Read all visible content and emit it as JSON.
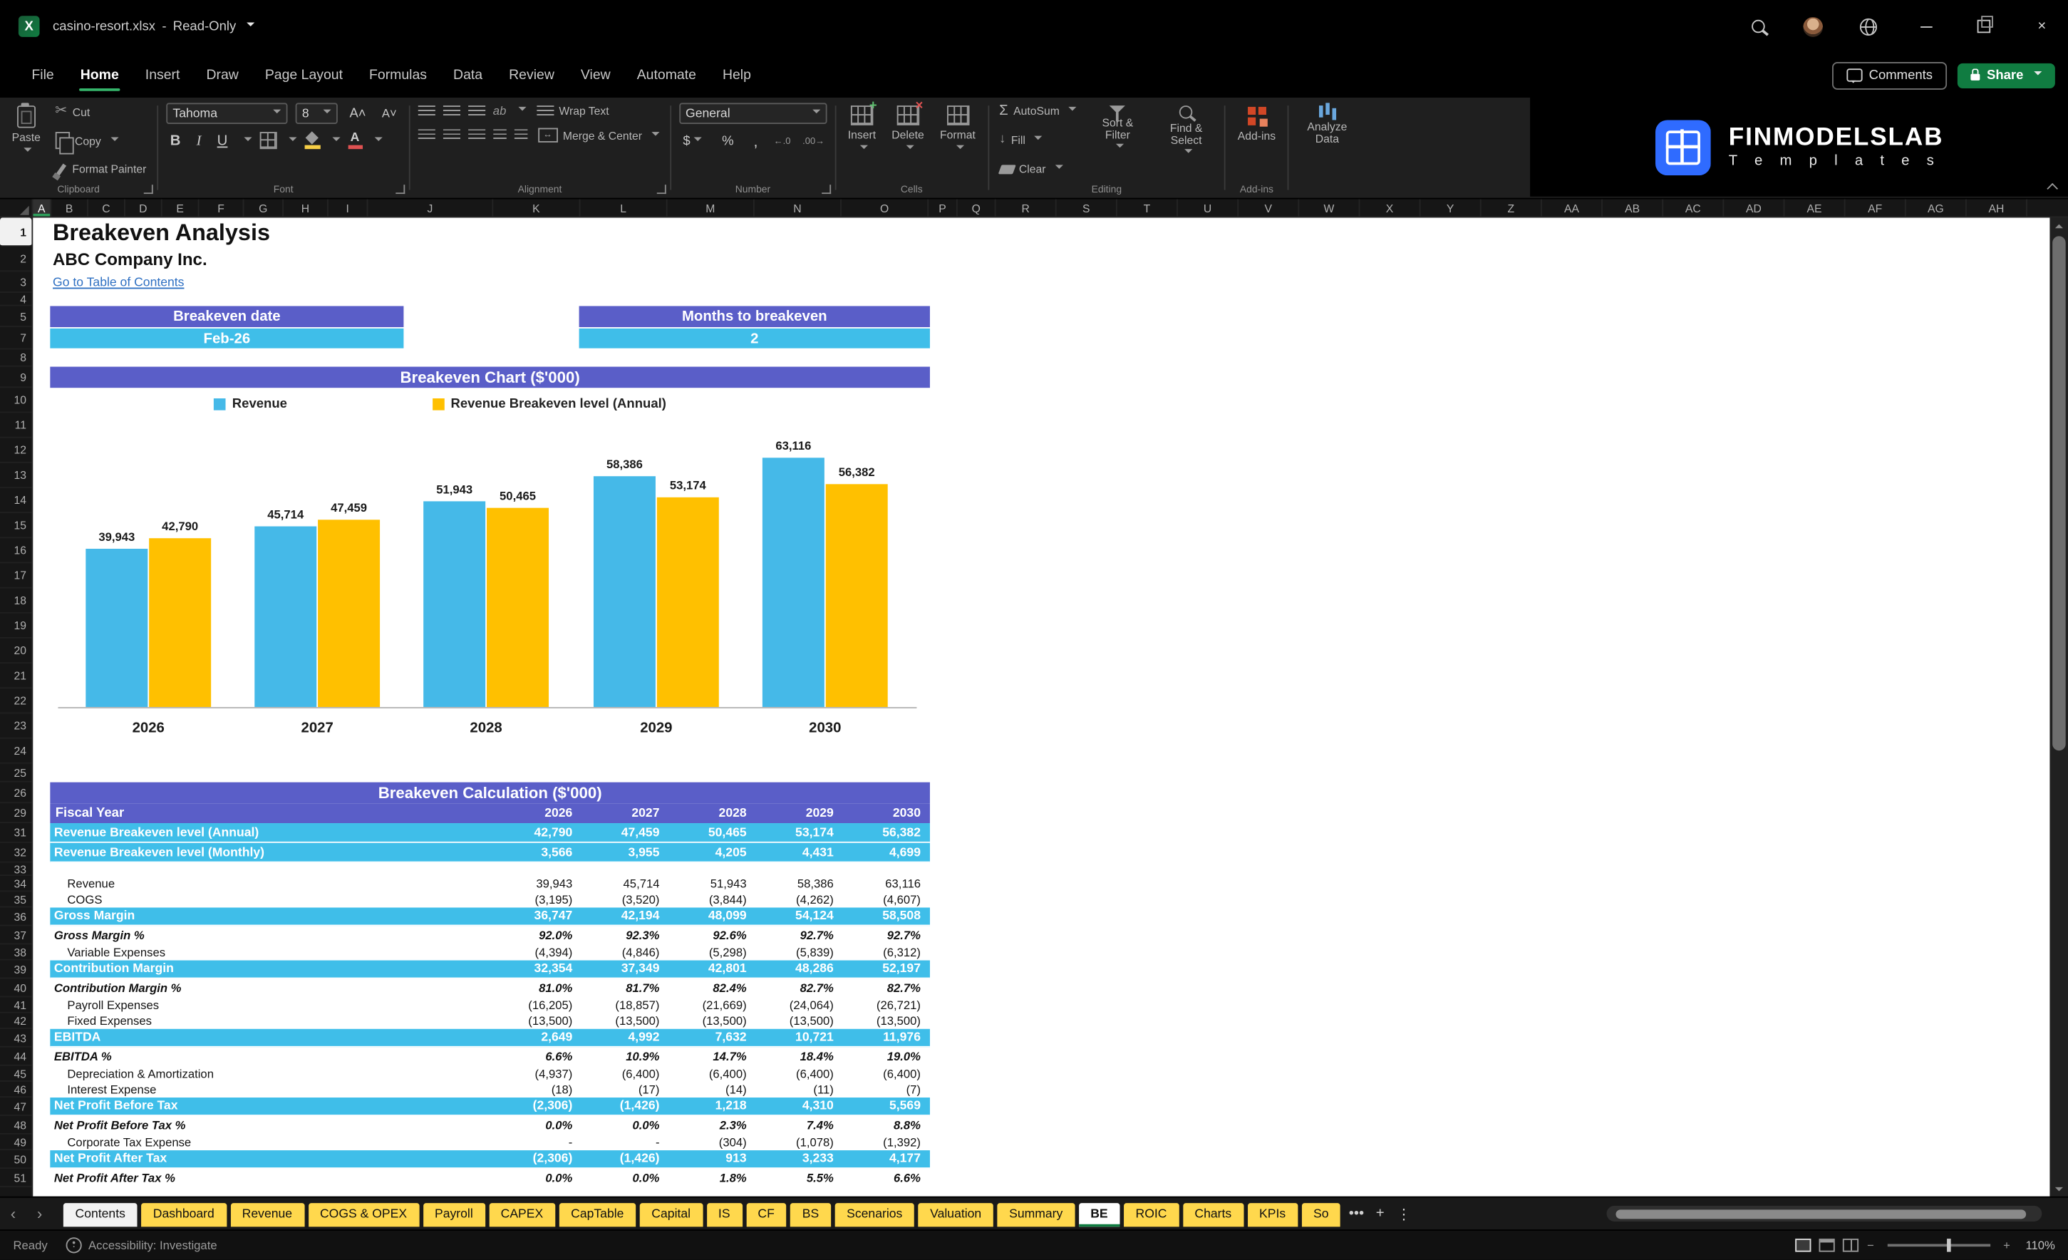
{
  "colors": {
    "purple": "#5A5EC8",
    "cyan": "#3FBEE9",
    "chart_blue": "#45B9E8",
    "chart_yellow": "#FFC000",
    "tab_yellow": "#FFD84D",
    "excel_green": "#107C41"
  },
  "titlebar": {
    "filename": "casino-resort.xlsx",
    "separator": "-",
    "mode": "Read-Only"
  },
  "menubar": {
    "items": [
      {
        "label": "File"
      },
      {
        "label": "Home",
        "cls": "active"
      },
      {
        "label": "Insert"
      },
      {
        "label": "Draw"
      },
      {
        "label": "Page Layout"
      },
      {
        "label": "Formulas"
      },
      {
        "label": "Data"
      },
      {
        "label": "Review"
      },
      {
        "label": "View"
      },
      {
        "label": "Automate"
      },
      {
        "label": "Help"
      }
    ],
    "comments": "Comments",
    "share": "Share"
  },
  "ribbon": {
    "paste": "Paste",
    "cut": "Cut",
    "copy": "Copy",
    "format_painter": "Format Painter",
    "font_name": "Tahoma",
    "font_size": "8",
    "wrap_text": "Wrap Text",
    "merge_center": "Merge & Center",
    "number_format": "General",
    "insert": "Insert",
    "delete": "Delete",
    "format": "Format",
    "autosum": "AutoSum",
    "fill": "Fill",
    "clear": "Clear",
    "sort_filter": "Sort & Filter",
    "find_select": "Find & Select",
    "addins": "Add-ins",
    "analyze": "Analyze Data",
    "groups": {
      "clipboard": "Clipboard",
      "font": "Font",
      "alignment": "Alignment",
      "number": "Number",
      "cells": "Cells",
      "editing": "Editing",
      "addins": "Add-ins"
    },
    "logo_title": "FINMODELSLAB",
    "logo_sub": "T e m p l a t e s"
  },
  "icons": {
    "bold": "B",
    "italic": "I",
    "underline": "U",
    "autosum_sigma": "Σ",
    "fill_arrow": "↓",
    "dollar": "$",
    "percent": "%",
    "comma": ",",
    "dec_inc": "←.0",
    "dec_dec": ".00→",
    "orientation": "ab",
    "prev_tab": "‹",
    "next_tab": "›",
    "more_tabs": "•••",
    "add_sheet": "+",
    "sheet_menu": "⋮",
    "zoom_out": "−",
    "zoom_in": "+",
    "merge_arrow": "↔"
  },
  "sheet": {
    "columns": [
      {
        "label": "A",
        "w": 14,
        "cls": "sel"
      },
      {
        "label": "B",
        "w": 28
      },
      {
        "label": "C",
        "w": 28
      },
      {
        "label": "D",
        "w": 28
      },
      {
        "label": "E",
        "w": 28
      },
      {
        "label": "F",
        "w": 34
      },
      {
        "label": "G",
        "w": 30
      },
      {
        "label": "H",
        "w": 34
      },
      {
        "label": "I",
        "w": 30
      },
      {
        "label": "J",
        "w": 95
      },
      {
        "label": "K",
        "w": 66
      },
      {
        "label": "L",
        "w": 66
      },
      {
        "label": "M",
        "w": 66
      },
      {
        "label": "N",
        "w": 66
      },
      {
        "label": "O",
        "w": 66
      },
      {
        "label": "P",
        "w": 22
      },
      {
        "label": "Q",
        "w": 29
      },
      {
        "label": "R",
        "w": 46
      },
      {
        "label": "S",
        "w": 46
      },
      {
        "label": "T",
        "w": 46
      },
      {
        "label": "U",
        "w": 46
      },
      {
        "label": "V",
        "w": 46
      },
      {
        "label": "W",
        "w": 46
      },
      {
        "label": "X",
        "w": 46
      },
      {
        "label": "Y",
        "w": 46
      },
      {
        "label": "Z",
        "w": 46
      },
      {
        "label": "AA",
        "w": 46
      },
      {
        "label": "AB",
        "w": 46
      },
      {
        "label": "AC",
        "w": 46
      },
      {
        "label": "AD",
        "w": 46
      },
      {
        "label": "AE",
        "w": 46
      },
      {
        "label": "AF",
        "w": 46
      },
      {
        "label": "AG",
        "w": 46
      },
      {
        "label": "AH",
        "w": 46
      }
    ],
    "rows": [
      {
        "n": 1,
        "h": 22,
        "cls": "sel"
      },
      {
        "n": 2,
        "h": 19
      },
      {
        "n": 3,
        "h": 16
      },
      {
        "n": 4,
        "h": 10
      },
      {
        "n": 5,
        "h": 16
      },
      {
        "n": 7,
        "h": 17
      },
      {
        "n": 8,
        "h": 13
      },
      {
        "n": 9,
        "h": 16
      },
      {
        "n": 10,
        "h": 19
      },
      {
        "n": 11,
        "h": 19
      },
      {
        "n": 12,
        "h": 19
      },
      {
        "n": 13,
        "h": 19
      },
      {
        "n": 14,
        "h": 19
      },
      {
        "n": 15,
        "h": 19
      },
      {
        "n": 16,
        "h": 19
      },
      {
        "n": 17,
        "h": 19
      },
      {
        "n": 18,
        "h": 19
      },
      {
        "n": 19,
        "h": 19
      },
      {
        "n": 20,
        "h": 19
      },
      {
        "n": 21,
        "h": 19
      },
      {
        "n": 22,
        "h": 19
      },
      {
        "n": 23,
        "h": 19
      },
      {
        "n": 24,
        "h": 19
      },
      {
        "n": 25,
        "h": 14
      },
      {
        "n": 26,
        "h": 16
      },
      {
        "n": 29,
        "h": 15
      },
      {
        "n": 31,
        "h": 15
      },
      {
        "n": 32,
        "h": 15
      },
      {
        "n": 33,
        "h": 10
      },
      {
        "n": 34,
        "h": 12
      },
      {
        "n": 35,
        "h": 12
      },
      {
        "n": 36,
        "h": 14
      },
      {
        "n": 37,
        "h": 14
      },
      {
        "n": 38,
        "h": 12
      },
      {
        "n": 39,
        "h": 14
      },
      {
        "n": 40,
        "h": 14
      },
      {
        "n": 41,
        "h": 12
      },
      {
        "n": 42,
        "h": 12
      },
      {
        "n": 43,
        "h": 14
      },
      {
        "n": 44,
        "h": 14
      },
      {
        "n": 45,
        "h": 12
      },
      {
        "n": 46,
        "h": 12
      },
      {
        "n": 47,
        "h": 14
      },
      {
        "n": 48,
        "h": 14
      },
      {
        "n": 49,
        "h": 12
      },
      {
        "n": 50,
        "h": 14
      },
      {
        "n": 51,
        "h": 14
      }
    ]
  },
  "cells": {
    "title": "Breakeven Analysis",
    "company": "ABC Company Inc.",
    "toc_link": "Go to Table of Contents",
    "breakeven_date_label": "Breakeven date",
    "breakeven_date_value": "Feb-26",
    "months_label": "Months to breakeven",
    "months_value": "2",
    "chart_title": "Breakeven Chart ($'000)",
    "calc_title": "Breakeven Calculation ($'000)"
  },
  "chart_data": {
    "type": "bar",
    "title": "Breakeven Chart ($'000)",
    "categories": [
      "2026",
      "2027",
      "2028",
      "2029",
      "2030"
    ],
    "series": [
      {
        "name": "Revenue",
        "color": "#45B9E8",
        "values": [
          39943,
          45714,
          51943,
          58386,
          63116
        ]
      },
      {
        "name": "Revenue Breakeven level (Annual)",
        "color": "#FFC000",
        "values": [
          42790,
          47459,
          50465,
          53174,
          56382
        ]
      }
    ],
    "xlabel": "",
    "ylabel": "",
    "ylim": [
      0,
      65000
    ],
    "grid": false,
    "legend_position": "top",
    "value_labels": true
  },
  "table": {
    "fiscal_label": "Fiscal Year",
    "years": [
      "2026",
      "2027",
      "2028",
      "2029",
      "2030"
    ],
    "rows": [
      {
        "label": "Revenue Breakeven level (Annual)",
        "cls": "band",
        "h": 15,
        "values": [
          "42,790",
          "47,459",
          "50,465",
          "53,174",
          "56,382"
        ]
      },
      {
        "label": "Revenue Breakeven level (Monthly)",
        "cls": "band",
        "h": 15,
        "values": [
          "3,566",
          "3,955",
          "4,205",
          "4,431",
          "4,699"
        ]
      },
      {
        "label": "",
        "cls": "spacer",
        "h": 10,
        "values": [
          "",
          "",
          "",
          "",
          ""
        ]
      },
      {
        "label": "Revenue",
        "cls": "sub",
        "h": 12,
        "values": [
          "39,943",
          "45,714",
          "51,943",
          "58,386",
          "63,116"
        ]
      },
      {
        "label": "COGS",
        "cls": "sub",
        "h": 12,
        "values": [
          "(3,195)",
          "(3,520)",
          "(3,844)",
          "(4,262)",
          "(4,607)"
        ]
      },
      {
        "label": "Gross Margin",
        "cls": "band",
        "h": 14,
        "values": [
          "36,747",
          "42,194",
          "48,099",
          "54,124",
          "58,508"
        ]
      },
      {
        "label": "Gross Margin %",
        "cls": "pct",
        "h": 14,
        "values": [
          "92.0%",
          "92.3%",
          "92.6%",
          "92.7%",
          "92.7%"
        ]
      },
      {
        "label": "Variable Expenses",
        "cls": "sub",
        "h": 12,
        "values": [
          "(4,394)",
          "(4,846)",
          "(5,298)",
          "(5,839)",
          "(6,312)"
        ]
      },
      {
        "label": "Contribution Margin",
        "cls": "band",
        "h": 14,
        "values": [
          "32,354",
          "37,349",
          "42,801",
          "48,286",
          "52,197"
        ]
      },
      {
        "label": "Contribution Margin %",
        "cls": "pct",
        "h": 14,
        "values": [
          "81.0%",
          "81.7%",
          "82.4%",
          "82.7%",
          "82.7%"
        ]
      },
      {
        "label": "Payroll Expenses",
        "cls": "sub",
        "h": 12,
        "values": [
          "(16,205)",
          "(18,857)",
          "(21,669)",
          "(24,064)",
          "(26,721)"
        ]
      },
      {
        "label": "Fixed Expenses",
        "cls": "sub",
        "h": 12,
        "values": [
          "(13,500)",
          "(13,500)",
          "(13,500)",
          "(13,500)",
          "(13,500)"
        ]
      },
      {
        "label": "EBITDA",
        "cls": "band",
        "h": 14,
        "values": [
          "2,649",
          "4,992",
          "7,632",
          "10,721",
          "11,976"
        ]
      },
      {
        "label": "EBITDA %",
        "cls": "pct",
        "h": 14,
        "values": [
          "6.6%",
          "10.9%",
          "14.7%",
          "18.4%",
          "19.0%"
        ]
      },
      {
        "label": "Depreciation & Amortization",
        "cls": "sub",
        "h": 12,
        "values": [
          "(4,937)",
          "(6,400)",
          "(6,400)",
          "(6,400)",
          "(6,400)"
        ]
      },
      {
        "label": "Interest Expense",
        "cls": "sub",
        "h": 12,
        "values": [
          "(18)",
          "(17)",
          "(14)",
          "(11)",
          "(7)"
        ]
      },
      {
        "label": "Net Profit Before Tax",
        "cls": "band",
        "h": 14,
        "values": [
          "(2,306)",
          "(1,426)",
          "1,218",
          "4,310",
          "5,569"
        ]
      },
      {
        "label": "Net Profit Before Tax %",
        "cls": "pct",
        "h": 14,
        "values": [
          "0.0%",
          "0.0%",
          "2.3%",
          "7.4%",
          "8.8%"
        ]
      },
      {
        "label": "Corporate Tax Expense",
        "cls": "sub",
        "h": 12,
        "values": [
          "-",
          "-",
          "(304)",
          "(1,078)",
          "(1,392)"
        ]
      },
      {
        "label": "Net Profit After Tax",
        "cls": "band",
        "h": 14,
        "values": [
          "(2,306)",
          "(1,426)",
          "913",
          "3,233",
          "4,177"
        ]
      },
      {
        "label": "Net Profit After Tax %",
        "cls": "pct",
        "h": 14,
        "values": [
          "0.0%",
          "0.0%",
          "1.8%",
          "5.5%",
          "6.6%"
        ]
      }
    ]
  },
  "tabs": {
    "items": [
      {
        "label": "Contents",
        "cls": "light"
      },
      {
        "label": "Dashboard",
        "cls": "yellow"
      },
      {
        "label": "Revenue",
        "cls": "yellow"
      },
      {
        "label": "COGS & OPEX",
        "cls": "yellow"
      },
      {
        "label": "Payroll",
        "cls": "yellow"
      },
      {
        "label": "CAPEX",
        "cls": "yellow"
      },
      {
        "label": "CapTable",
        "cls": "yellow"
      },
      {
        "label": "Capital",
        "cls": "yellow"
      },
      {
        "label": "IS",
        "cls": "yellow"
      },
      {
        "label": "CF",
        "cls": "yellow"
      },
      {
        "label": "BS",
        "cls": "yellow"
      },
      {
        "label": "Scenarios",
        "cls": "yellow"
      },
      {
        "label": "Valuation",
        "cls": "yellow"
      },
      {
        "label": "Summary",
        "cls": "yellow"
      },
      {
        "label": "BE",
        "cls": "active"
      },
      {
        "label": "ROIC",
        "cls": "yellow"
      },
      {
        "label": "Charts",
        "cls": "yellow"
      },
      {
        "label": "KPIs",
        "cls": "yellow"
      },
      {
        "label": "So",
        "cls": "yellow"
      }
    ]
  },
  "statusbar": {
    "ready": "Ready",
    "accessibility": "Accessibility: Investigate",
    "zoom": "110%"
  }
}
